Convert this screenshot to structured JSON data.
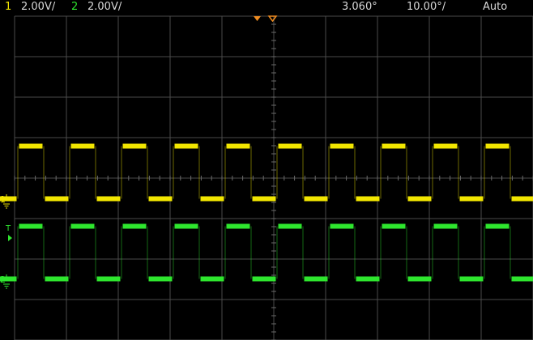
{
  "status_bar": {
    "ch1_number": "1",
    "ch1_scale": "2.00V/",
    "ch2_number": "2",
    "ch2_scale": "2.00V/",
    "time_delay": "3.060°",
    "timebase": "10.00°/",
    "trigger_mode": "Auto"
  },
  "markers": {
    "ch1_label": "1",
    "ch2_label": "2",
    "trigger_label": "T"
  },
  "colors": {
    "ch1": "#f2e600",
    "ch2": "#2ee62e",
    "text": "#d8d8d8",
    "grid": "#4a4a4a",
    "background": "#000000",
    "marker": "#f08c20"
  },
  "waveforms": {
    "grid_divisions": [
      10,
      8
    ],
    "ch1": {
      "shape": "square",
      "cycles_on_screen": 10,
      "duty_percent": 50,
      "high_level_div": 1.3,
      "low_level_div": 0.0
    },
    "ch2": {
      "shape": "square",
      "cycles_on_screen": 10,
      "duty_percent": 50,
      "high_level_div": 1.3,
      "low_level_div": 0.0
    }
  }
}
